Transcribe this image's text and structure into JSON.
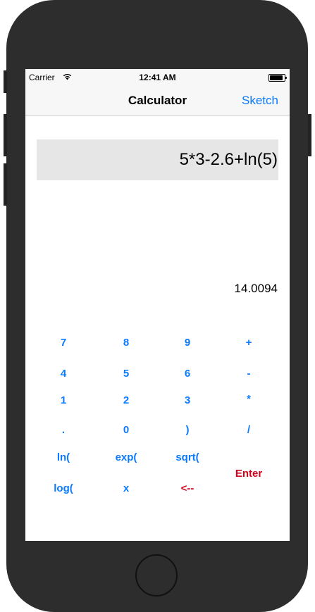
{
  "status_bar": {
    "carrier": "Carrier",
    "time": "12:41 AM"
  },
  "nav": {
    "title": "Calculator",
    "right_button": "Sketch"
  },
  "display": {
    "expression": "5*3-2.6+ln(5)",
    "result": "14.0094"
  },
  "keypad": {
    "row1": [
      "7",
      "8",
      "9",
      "+"
    ],
    "row2": [
      "4",
      "5",
      "6",
      "-"
    ],
    "row3": [
      "1",
      "2",
      "3",
      "*"
    ],
    "row4": [
      ".",
      "0",
      ")",
      "/"
    ],
    "row5": [
      "ln(",
      "exp(",
      "sqrt("
    ],
    "row6": [
      "log(",
      "x",
      "<--"
    ],
    "enter": "Enter"
  },
  "colors": {
    "accent": "#0a7aff",
    "danger": "#d0021b",
    "display_bg": "#e6e6e6"
  }
}
